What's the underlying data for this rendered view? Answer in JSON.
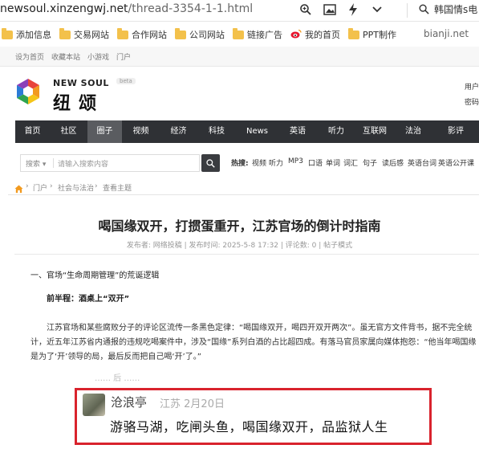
{
  "browser": {
    "url_domain": "newsoul.xinzengwj.net",
    "url_path": "/thread-3354-1-1.html",
    "search_text": "韩国情s电",
    "bookmarks": [
      "添加信息",
      "交易网站",
      "合作网站",
      "公司网站",
      "链接广告",
      "我的首页",
      "PPT制作"
    ],
    "side_label": "bianji.net"
  },
  "site": {
    "top_links": [
      "设为首页",
      "收藏本站",
      "小游戏",
      "门户"
    ],
    "logo_en": "NEW SOUL",
    "logo_cn": "纽颂",
    "beta": "beta",
    "user_hint": "用户",
    "password_hint": "密码",
    "nav": [
      "首页",
      "社区",
      "圈子",
      "视频",
      "经济",
      "科技",
      "News",
      "英语",
      "听力",
      "互联网",
      "法治",
      "影评"
    ],
    "nav_active": "圈子",
    "search": {
      "category": "搜索",
      "placeholder": "请输入搜索内容"
    },
    "hot_label": "热搜:",
    "hot_words": [
      "视频",
      "听力",
      "MP3",
      "口语",
      "单词",
      "词汇",
      "句子",
      "读后感",
      "英语台词",
      "英语公开课"
    ],
    "breadcrumb": [
      "门户",
      "社会与法治",
      "查看主题"
    ]
  },
  "article": {
    "title": "喝国缘双开，打掼蛋重开，江苏官场的倒计时指南",
    "meta": "发布者: 网络投稿 | 发布时间: 2025-5-8 17:32 | 评论数: 0 | 帖子模式",
    "section": "一、官场“生命周期管理”的荒诞逻辑",
    "subhead": "前半程：酒桌上“双开”",
    "paragraph": "江苏官场和某些腐败分子的评论区流传一条黑色定律：“喝国缘双开，喝四开双开两次”。虽无官方文件背书，据不完全统计，近五年江苏省内通报的违规吃喝案件中，涉及“国缘”系列白酒的占比超四成。有落马官员家属向媒体抱怨：“他当年喝国缘是为了‘开’领导的局，最后反而把自己喝‘开’了。”",
    "faded": "…… 后 ……"
  },
  "comment": {
    "name": "沧浪亭",
    "location": "江苏",
    "date": "2月20日",
    "text": "游骆马湖，吃闸头鱼，喝国缘双开，品监狱人生",
    "border_color": "#d9232d"
  }
}
